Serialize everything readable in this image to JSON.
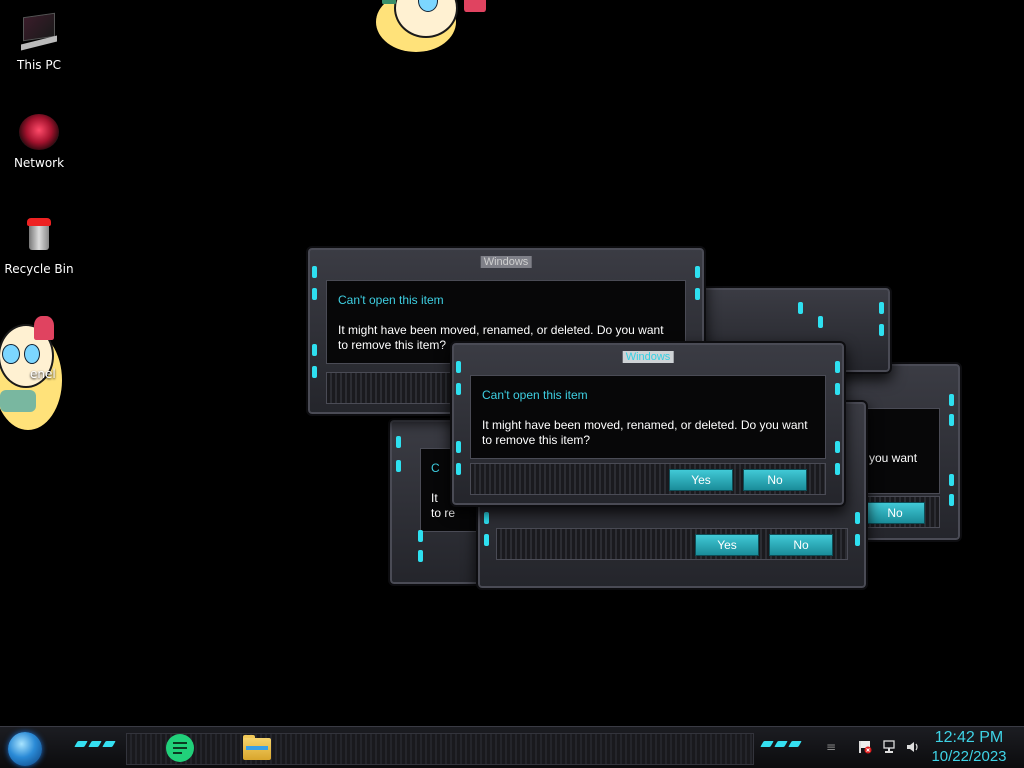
{
  "desktop": {
    "icons": [
      {
        "label": "This PC"
      },
      {
        "label": "Network"
      },
      {
        "label": "Recycle Bin"
      },
      {
        "label": "enel"
      }
    ]
  },
  "dialogs": [
    {
      "title": "Windows",
      "heading": "Can't open this item",
      "message": "It might have been moved, renamed, or deleted. Do you want to remove this item?",
      "yes": "Yes",
      "no": "No"
    },
    {
      "title": "Windows",
      "heading": "Can't open this item",
      "message": "It might have been moved, renamed, or deleted. Do you want to remove this item?",
      "yes": "Yes",
      "no": "No"
    },
    {
      "title": "Windows",
      "heading": "Can't open this item",
      "message": "It might have been moved, renamed, or deleted. Do you want to remove this item?",
      "yes": "Yes",
      "no": "No"
    },
    {
      "title": "Windows",
      "heading": "Can't open this item",
      "message": "It might have been moved, renamed, or deleted. Do you want to remove this item?",
      "yes": "Yes",
      "no": "No"
    },
    {
      "title": "Windows",
      "heading": "Can't open this item",
      "message": "It might have been moved, renamed, or deleted. Do you want to remove this item?",
      "yes": "Yes",
      "no": "No"
    },
    {
      "title": "Windows",
      "heading": "Can't open this item",
      "message": "It might have been moved, renamed, or deleted. Do you want to remove this item?",
      "yes": "Yes",
      "no": "No"
    }
  ],
  "partial_text": {
    "you_want": "you want",
    "no": "No",
    "c": "C",
    "it": "It",
    "to_re": "to re"
  },
  "taskbar": {
    "apps": [
      "notes-app-icon",
      "file-explorer-icon"
    ],
    "tray": {
      "flag_icon": "action-center-flag-icon",
      "network_icon": "network-icon",
      "volume_icon": "volume-icon"
    },
    "clock": {
      "time": "12:42 PM",
      "date": "10/22/2023"
    }
  },
  "colors": {
    "accent_cyan": "#3ecfe2",
    "button_cyan": "#2aa8b6",
    "dialog_frame": "#2f3037",
    "background": "#000000"
  }
}
